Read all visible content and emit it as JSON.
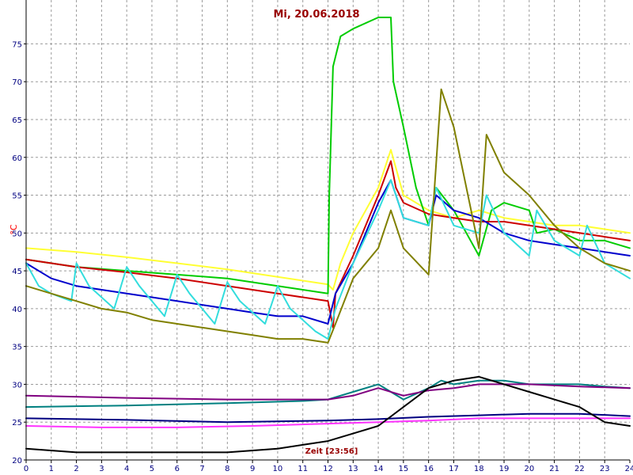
{
  "chart_data": {
    "type": "line",
    "title": "Mi, 20.06.2018",
    "xlabel": "Zeit [23:56]",
    "ylabel": "°C",
    "xlim": [
      0,
      24
    ],
    "ylim": [
      20,
      80
    ],
    "x_ticks": [
      "0",
      "1",
      "2",
      "3",
      "4",
      "5",
      "6",
      "7",
      "8",
      "9",
      "10",
      "11",
      "12",
      "13",
      "14",
      "15",
      "16",
      "17",
      "18",
      "19",
      "20",
      "21",
      "22",
      "23",
      "24"
    ],
    "y_ticks": [
      "20",
      "25",
      "30",
      "35",
      "40",
      "45",
      "50",
      "55",
      "60",
      "65",
      "70",
      "75"
    ],
    "grid": true,
    "series": [
      {
        "color": "#ffff33",
        "points": [
          [
            0,
            48
          ],
          [
            2,
            47.5
          ],
          [
            4,
            46.8
          ],
          [
            6,
            46
          ],
          [
            8,
            45.2
          ],
          [
            10,
            44.2
          ],
          [
            12,
            43.2
          ],
          [
            12.2,
            42.5
          ],
          [
            12.5,
            46
          ],
          [
            13,
            50
          ],
          [
            14,
            56
          ],
          [
            14.5,
            61
          ],
          [
            15,
            55
          ],
          [
            16,
            53
          ],
          [
            17,
            52
          ],
          [
            18,
            53
          ],
          [
            19,
            52
          ],
          [
            20,
            51.5
          ],
          [
            21,
            51
          ],
          [
            22,
            51
          ],
          [
            23,
            50.5
          ],
          [
            24,
            50
          ]
        ]
      },
      {
        "color": "#00cc00",
        "points": [
          [
            0,
            46.5
          ],
          [
            2,
            45.5
          ],
          [
            4,
            45
          ],
          [
            6,
            44.5
          ],
          [
            8,
            44
          ],
          [
            10,
            43
          ],
          [
            12,
            42
          ],
          [
            12.05,
            55
          ],
          [
            12.2,
            72
          ],
          [
            12.5,
            76
          ],
          [
            13,
            77
          ],
          [
            14,
            78.5
          ],
          [
            14.5,
            78.5
          ],
          [
            14.6,
            70
          ],
          [
            15,
            64
          ],
          [
            15.5,
            56
          ],
          [
            16,
            51
          ],
          [
            16.3,
            56
          ],
          [
            17,
            53
          ],
          [
            17.5,
            50
          ],
          [
            18,
            47
          ],
          [
            18.5,
            53
          ],
          [
            19,
            54
          ],
          [
            20,
            53
          ],
          [
            20.3,
            50
          ],
          [
            21,
            50.5
          ],
          [
            22,
            49
          ],
          [
            23,
            49
          ],
          [
            24,
            48
          ]
        ]
      },
      {
        "color": "#cc0000",
        "points": [
          [
            0,
            46.5
          ],
          [
            2,
            45.5
          ],
          [
            4,
            44.8
          ],
          [
            6,
            44
          ],
          [
            8,
            43
          ],
          [
            10,
            42
          ],
          [
            12,
            41
          ],
          [
            12.2,
            37.5
          ],
          [
            12.3,
            42
          ],
          [
            13,
            47
          ],
          [
            14,
            55
          ],
          [
            14.5,
            59.5
          ],
          [
            14.7,
            56
          ],
          [
            15,
            54
          ],
          [
            16,
            52.5
          ],
          [
            17,
            52
          ],
          [
            18,
            51.5
          ],
          [
            19,
            51.5
          ],
          [
            20,
            51
          ],
          [
            21,
            50.5
          ],
          [
            22,
            50
          ],
          [
            23,
            49.5
          ],
          [
            24,
            49
          ]
        ]
      },
      {
        "color": "#0000cc",
        "points": [
          [
            0,
            46
          ],
          [
            1,
            44
          ],
          [
            2,
            43
          ],
          [
            3,
            42.5
          ],
          [
            4,
            42
          ],
          [
            5,
            41.5
          ],
          [
            6,
            41
          ],
          [
            7,
            40.5
          ],
          [
            8,
            40
          ],
          [
            9,
            39.5
          ],
          [
            10,
            39
          ],
          [
            11,
            39
          ],
          [
            12,
            38
          ],
          [
            12.3,
            42
          ],
          [
            13,
            46
          ],
          [
            14,
            54
          ],
          [
            14.5,
            57
          ],
          [
            15,
            52
          ],
          [
            16,
            51
          ],
          [
            16.3,
            55
          ],
          [
            17,
            53
          ],
          [
            18,
            52
          ],
          [
            19,
            50
          ],
          [
            20,
            49
          ],
          [
            21,
            48.5
          ],
          [
            22,
            48
          ],
          [
            23,
            47.5
          ],
          [
            24,
            47
          ]
        ]
      },
      {
        "color": "#33dddd",
        "points": [
          [
            0,
            46
          ],
          [
            0.5,
            43
          ],
          [
            1,
            42
          ],
          [
            1.8,
            41
          ],
          [
            2,
            46
          ],
          [
            2.5,
            43
          ],
          [
            3.5,
            40
          ],
          [
            4,
            45.5
          ],
          [
            4.5,
            43
          ],
          [
            5.5,
            39
          ],
          [
            6,
            44.5
          ],
          [
            6.5,
            42
          ],
          [
            7.5,
            38
          ],
          [
            8,
            43.5
          ],
          [
            8.5,
            41
          ],
          [
            9.5,
            38
          ],
          [
            10,
            43
          ],
          [
            10.5,
            40
          ],
          [
            11.5,
            37
          ],
          [
            12,
            36
          ],
          [
            12.3,
            40
          ],
          [
            13,
            46
          ],
          [
            14,
            53
          ],
          [
            14.5,
            57
          ],
          [
            15,
            52
          ],
          [
            16,
            51
          ],
          [
            16.3,
            56
          ],
          [
            17,
            51
          ],
          [
            18,
            50
          ],
          [
            18.3,
            55
          ],
          [
            19,
            50
          ],
          [
            20,
            47
          ],
          [
            20.3,
            53
          ],
          [
            21,
            49
          ],
          [
            22,
            47
          ],
          [
            22.3,
            51
          ],
          [
            23,
            46
          ],
          [
            24,
            44
          ]
        ]
      },
      {
        "color": "#808000",
        "points": [
          [
            0,
            43
          ],
          [
            1,
            42
          ],
          [
            2,
            41
          ],
          [
            3,
            40
          ],
          [
            4,
            39.5
          ],
          [
            5,
            38.5
          ],
          [
            6,
            38
          ],
          [
            7,
            37.5
          ],
          [
            8,
            37
          ],
          [
            9,
            36.5
          ],
          [
            10,
            36
          ],
          [
            11,
            36
          ],
          [
            12,
            35.5
          ],
          [
            12.3,
            38
          ],
          [
            13,
            44
          ],
          [
            14,
            48
          ],
          [
            14.5,
            53
          ],
          [
            15,
            48
          ],
          [
            16,
            44.5
          ],
          [
            16.5,
            69
          ],
          [
            17,
            64
          ],
          [
            18,
            48
          ],
          [
            18.3,
            63
          ],
          [
            19,
            58
          ],
          [
            20,
            55
          ],
          [
            21,
            51
          ],
          [
            22,
            48
          ],
          [
            23,
            46
          ],
          [
            24,
            45
          ]
        ]
      },
      {
        "color": "#008080",
        "points": [
          [
            0,
            27
          ],
          [
            4,
            27.2
          ],
          [
            8,
            27.5
          ],
          [
            11,
            27.8
          ],
          [
            12,
            28
          ],
          [
            13,
            29
          ],
          [
            14,
            30
          ],
          [
            14.5,
            29
          ],
          [
            15,
            28
          ],
          [
            16,
            29.5
          ],
          [
            16.5,
            30.5
          ],
          [
            17,
            30
          ],
          [
            18,
            30.5
          ],
          [
            19,
            30.5
          ],
          [
            20,
            30
          ],
          [
            21,
            30
          ],
          [
            22,
            30
          ],
          [
            23,
            29.7
          ],
          [
            24,
            29.5
          ]
        ]
      },
      {
        "color": "#800080",
        "points": [
          [
            0,
            28.5
          ],
          [
            4,
            28.2
          ],
          [
            8,
            28
          ],
          [
            12,
            28
          ],
          [
            13,
            28.5
          ],
          [
            14,
            29.5
          ],
          [
            15,
            28.5
          ],
          [
            16,
            29.2
          ],
          [
            17,
            29.5
          ],
          [
            18,
            30
          ],
          [
            20,
            30
          ],
          [
            22,
            29.7
          ],
          [
            24,
            29.5
          ]
        ]
      },
      {
        "color": "#000080",
        "points": [
          [
            0,
            25.5
          ],
          [
            4,
            25.3
          ],
          [
            8,
            25
          ],
          [
            12,
            25.2
          ],
          [
            14,
            25.4
          ],
          [
            16,
            25.7
          ],
          [
            18,
            25.9
          ],
          [
            20,
            26.1
          ],
          [
            22,
            26.1
          ],
          [
            24,
            25.8
          ]
        ]
      },
      {
        "color": "#ff33ff",
        "points": [
          [
            0,
            24.5
          ],
          [
            3,
            24.3
          ],
          [
            6,
            24.3
          ],
          [
            9,
            24.5
          ],
          [
            12,
            24.8
          ],
          [
            14,
            25
          ],
          [
            16,
            25.2
          ],
          [
            18,
            25.5
          ],
          [
            20,
            25.5
          ],
          [
            22,
            25.5
          ],
          [
            24,
            25.5
          ]
        ]
      },
      {
        "color": "#000000",
        "points": [
          [
            0,
            21.5
          ],
          [
            2,
            21
          ],
          [
            4,
            21
          ],
          [
            6,
            21
          ],
          [
            8,
            21
          ],
          [
            10,
            21.5
          ],
          [
            11,
            22
          ],
          [
            12,
            22.5
          ],
          [
            13,
            23.5
          ],
          [
            14,
            24.5
          ],
          [
            15,
            27
          ],
          [
            16,
            29.5
          ],
          [
            17,
            30.5
          ],
          [
            18,
            31
          ],
          [
            19,
            30
          ],
          [
            20,
            29
          ],
          [
            21,
            28
          ],
          [
            22,
            27
          ],
          [
            23,
            25
          ],
          [
            24,
            24.5
          ]
        ]
      }
    ]
  }
}
